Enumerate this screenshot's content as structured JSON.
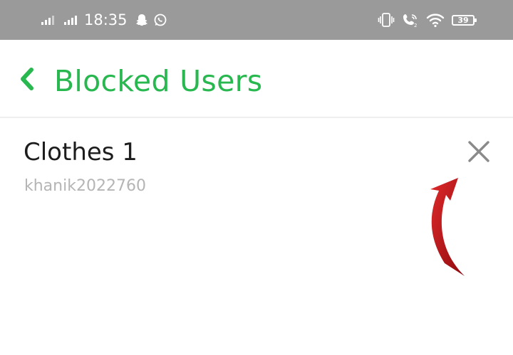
{
  "status_bar": {
    "time": "18:35",
    "battery": "39",
    "left_icons": [
      "signal-bars-icon",
      "signal-bars-icon",
      "snapchat-ghost-icon",
      "whatsapp-icon"
    ],
    "right_icons": [
      "vibrate-icon",
      "wifi-calling-icon",
      "wifi-icon",
      "battery-icon"
    ]
  },
  "header": {
    "title": "Blocked Users",
    "back_icon": "chevron-left-icon"
  },
  "blocked_users": [
    {
      "display_name": "Clothes 1",
      "username": "khanik2022760",
      "action_icon": "close-icon"
    }
  ],
  "annotation": {
    "icon": "curved-arrow-icon",
    "color": "#c8141b"
  },
  "colors": {
    "status_bar": "#9a9a9a",
    "accent": "#28b84f",
    "name": "#1d1d1d",
    "username": "#b5b5b5",
    "close_icon": "#8a8a8a"
  }
}
